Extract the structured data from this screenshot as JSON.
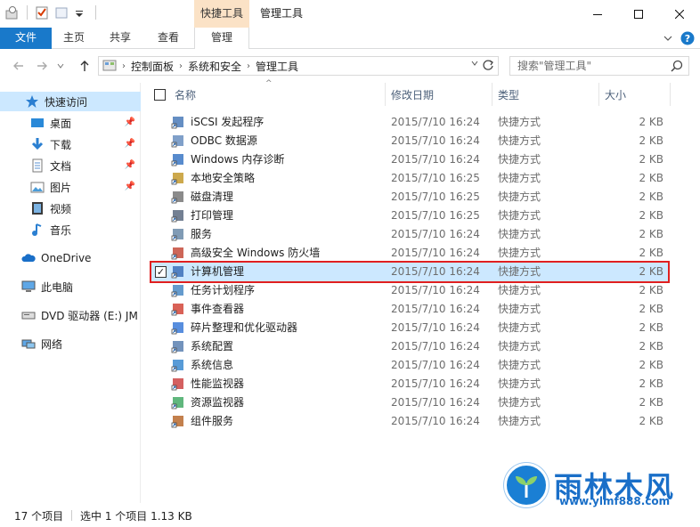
{
  "window": {
    "context_tab_title": "快捷工具",
    "title": "管理工具"
  },
  "ribbon": {
    "tabs": [
      {
        "label": "文件"
      },
      {
        "label": "主页"
      },
      {
        "label": "共享"
      },
      {
        "label": "查看"
      },
      {
        "label": "管理"
      }
    ]
  },
  "address": {
    "crumbs": [
      "控制面板",
      "系统和安全",
      "管理工具"
    ]
  },
  "search": {
    "placeholder": "搜索\"管理工具\""
  },
  "sidebar": {
    "items": [
      {
        "label": "快速访问",
        "icon": "star-icon"
      },
      {
        "label": "桌面",
        "icon": "desktop-icon"
      },
      {
        "label": "下载",
        "icon": "download-icon"
      },
      {
        "label": "文档",
        "icon": "document-icon"
      },
      {
        "label": "图片",
        "icon": "picture-icon"
      },
      {
        "label": "视频",
        "icon": "video-icon"
      },
      {
        "label": "音乐",
        "icon": "music-icon"
      },
      {
        "label": "OneDrive",
        "icon": "cloud-icon"
      },
      {
        "label": "此电脑",
        "icon": "computer-icon"
      },
      {
        "label": "DVD 驱动器 (E:) JM",
        "icon": "dvd-icon"
      },
      {
        "label": "网络",
        "icon": "network-icon"
      }
    ]
  },
  "columns": {
    "name": "名称",
    "date": "修改日期",
    "type": "类型",
    "size": "大小"
  },
  "files": [
    {
      "name": "iSCSI 发起程序",
      "date": "2015/7/10 16:24",
      "type": "快捷方式",
      "size": "2 KB"
    },
    {
      "name": "ODBC 数据源",
      "date": "2015/7/10 16:24",
      "type": "快捷方式",
      "size": "2 KB"
    },
    {
      "name": "Windows 内存诊断",
      "date": "2015/7/10 16:24",
      "type": "快捷方式",
      "size": "2 KB"
    },
    {
      "name": "本地安全策略",
      "date": "2015/7/10 16:25",
      "type": "快捷方式",
      "size": "2 KB"
    },
    {
      "name": "磁盘清理",
      "date": "2015/7/10 16:25",
      "type": "快捷方式",
      "size": "2 KB"
    },
    {
      "name": "打印管理",
      "date": "2015/7/10 16:25",
      "type": "快捷方式",
      "size": "2 KB"
    },
    {
      "name": "服务",
      "date": "2015/7/10 16:24",
      "type": "快捷方式",
      "size": "2 KB"
    },
    {
      "name": "高级安全 Windows 防火墙",
      "date": "2015/7/10 16:24",
      "type": "快捷方式",
      "size": "2 KB"
    },
    {
      "name": "计算机管理",
      "date": "2015/7/10 16:24",
      "type": "快捷方式",
      "size": "2 KB"
    },
    {
      "name": "任务计划程序",
      "date": "2015/7/10 16:24",
      "type": "快捷方式",
      "size": "2 KB"
    },
    {
      "name": "事件查看器",
      "date": "2015/7/10 16:24",
      "type": "快捷方式",
      "size": "2 KB"
    },
    {
      "name": "碎片整理和优化驱动器",
      "date": "2015/7/10 16:24",
      "type": "快捷方式",
      "size": "2 KB"
    },
    {
      "name": "系统配置",
      "date": "2015/7/10 16:24",
      "type": "快捷方式",
      "size": "2 KB"
    },
    {
      "name": "系统信息",
      "date": "2015/7/10 16:24",
      "type": "快捷方式",
      "size": "2 KB"
    },
    {
      "name": "性能监视器",
      "date": "2015/7/10 16:24",
      "type": "快捷方式",
      "size": "2 KB"
    },
    {
      "name": "资源监视器",
      "date": "2015/7/10 16:24",
      "type": "快捷方式",
      "size": "2 KB"
    },
    {
      "name": "组件服务",
      "date": "2015/7/10 16:24",
      "type": "快捷方式",
      "size": "2 KB"
    }
  ],
  "selected_index": 8,
  "status": {
    "count": "17 个项目",
    "selection": "选中 1 个项目  1.13 KB"
  },
  "watermark": {
    "title": "雨林木风",
    "url": "www.ylmf888.com"
  },
  "colors": {
    "accent": "#1979ca",
    "selection": "#cce8ff",
    "highlight_border": "#e02020",
    "context_tab": "#fbe2c6"
  }
}
